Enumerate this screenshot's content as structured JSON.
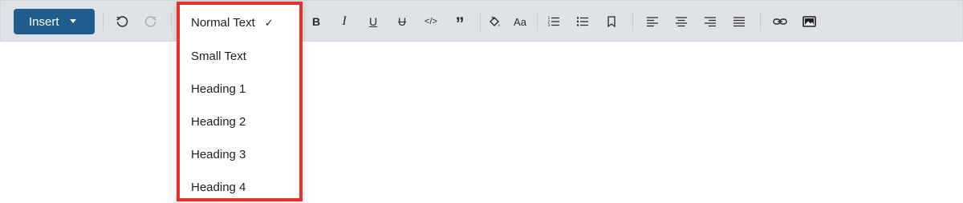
{
  "toolbar": {
    "insert_label": "Insert",
    "bold_label": "B",
    "italic_label": "I",
    "underline_label": "U",
    "strike_label": "U",
    "code_label": "</>",
    "quote_label": "”",
    "font_size_label": "Aa"
  },
  "dropdown": {
    "items": [
      {
        "label": "Normal Text",
        "selected": true
      },
      {
        "label": "Small Text",
        "selected": false
      },
      {
        "label": "Heading 1",
        "selected": false
      },
      {
        "label": "Heading 2",
        "selected": false
      },
      {
        "label": "Heading 3",
        "selected": false
      },
      {
        "label": "Heading 4",
        "selected": false
      }
    ],
    "check_mark": "✓",
    "highlight_color": "#e8302a"
  },
  "colors": {
    "toolbar_bg": "#dfe2e7",
    "insert_button_bg": "#1f5e8c"
  },
  "icons": [
    "undo-icon",
    "redo-icon",
    "fill-color-icon",
    "ordered-list-icon",
    "bullet-list-icon",
    "bookmark-icon",
    "align-left-icon",
    "align-center-icon",
    "align-right-icon",
    "align-justify-icon",
    "link-icon",
    "image-icon"
  ]
}
